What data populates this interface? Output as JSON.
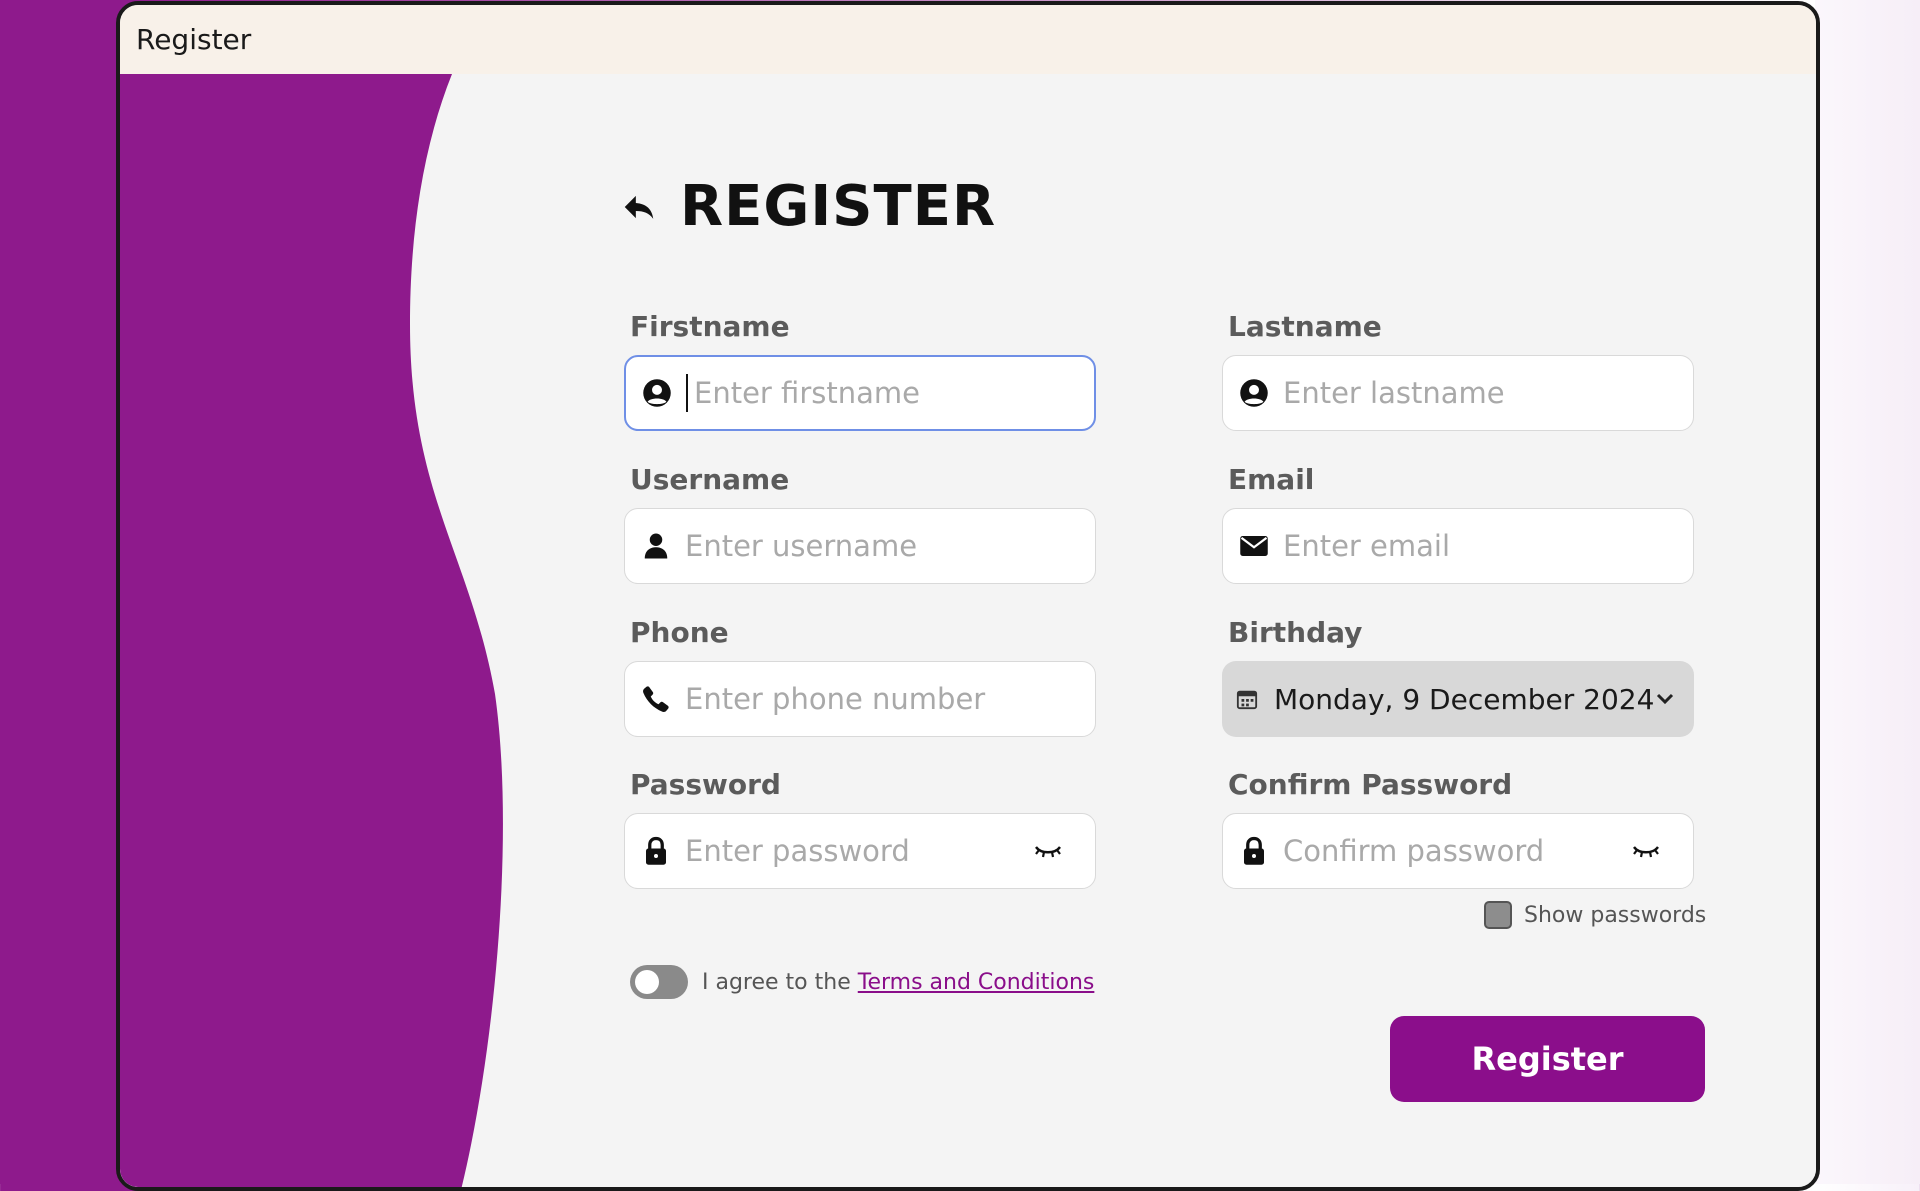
{
  "window": {
    "title": "Register"
  },
  "page": {
    "title": "REGISTER",
    "back_icon": "back-arrow-icon"
  },
  "form": {
    "firstname": {
      "label": "Firstname",
      "placeholder": "Enter firstname",
      "value": "",
      "icon": "user-circle-icon",
      "focused": true
    },
    "lastname": {
      "label": "Lastname",
      "placeholder": "Enter lastname",
      "value": "",
      "icon": "user-circle-icon"
    },
    "username": {
      "label": "Username",
      "placeholder": "Enter username",
      "value": "",
      "icon": "user-icon"
    },
    "email": {
      "label": "Email",
      "placeholder": "Enter email",
      "value": "",
      "icon": "envelope-icon"
    },
    "phone": {
      "label": "Phone",
      "placeholder": "Enter phone number",
      "value": "",
      "icon": "phone-icon"
    },
    "birthday": {
      "label": "Birthday",
      "value": "Monday, 9 December 2024",
      "icon": "calendar-icon"
    },
    "password": {
      "label": "Password",
      "placeholder": "Enter password",
      "value": "",
      "icon": "lock-icon"
    },
    "confirm_password": {
      "label": "Confirm Password",
      "placeholder": "Confirm password",
      "value": "",
      "icon": "lock-icon"
    },
    "show_passwords": {
      "label": "Show passwords",
      "checked": false
    },
    "terms": {
      "text": "I agree to the",
      "link": "Terms and Conditions",
      "agreed": false
    },
    "submit_label": "Register"
  },
  "colors": {
    "accent": "#8b0e8b",
    "sidebar_wave": "#8e1a8c",
    "background": "#f4f4f4",
    "titlebar": "#f8f1e9",
    "focus_border": "#6f8fe6"
  }
}
